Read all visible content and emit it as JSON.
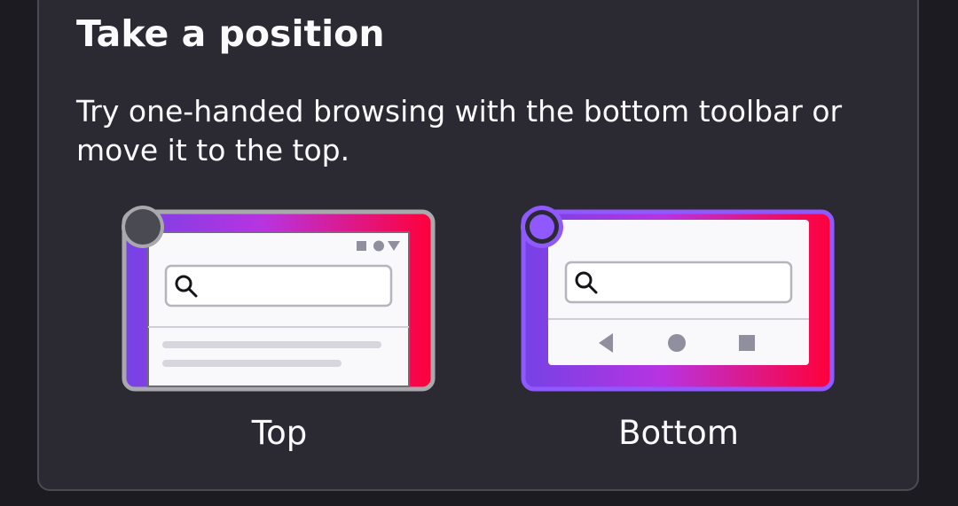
{
  "dialog": {
    "title": "Take a position",
    "description": "Try one-handed browsing with the bottom toolbar or move it to the top."
  },
  "options": [
    {
      "label": "Top",
      "selected": false
    },
    {
      "label": "Bottom",
      "selected": true
    }
  ],
  "colors": {
    "card_bg": "#2b2a33",
    "page_bg": "#1c1b22",
    "text": "#fbfbfe",
    "accent_purple": "#9059ff",
    "gradient_start": "#7542e5",
    "gradient_end": "#ff0039",
    "unselected_border": "#a9a9ad"
  }
}
